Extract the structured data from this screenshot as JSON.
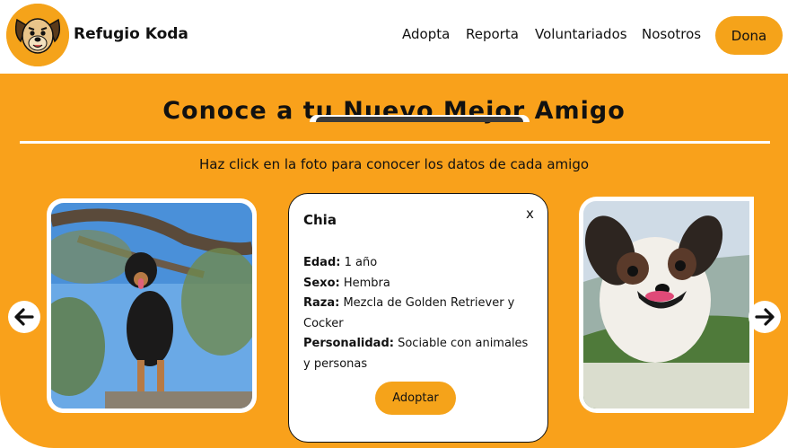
{
  "header": {
    "brand": "Refugio Koda",
    "nav": [
      "Adopta",
      "Reporta",
      "Voluntariados",
      "Nosotros"
    ],
    "donate_label": "Dona"
  },
  "hero": {
    "title": "Conoce a tu Nuevo Mejor Amigo",
    "subtitle": "Haz click en la foto para conocer los datos de cada amigo"
  },
  "modal": {
    "name": "Chia",
    "close": "x",
    "fields": [
      {
        "label": "Edad:",
        "value": "1 año"
      },
      {
        "label": "Sexo:",
        "value": "Hembra"
      },
      {
        "label": "Raza:",
        "value": "Mezcla de Golden Retriever y Cocker"
      },
      {
        "label": "Personalidad:",
        "value": "Sociable con animales y personas"
      }
    ],
    "adopt_label": "Adoptar"
  },
  "colors": {
    "accent": "#f9a11b",
    "button": "#f5a31a",
    "text": "#111111",
    "background": "#ffffff"
  },
  "icons": {
    "logo": "dog-face-icon",
    "prev": "arrow-left-icon",
    "next": "arrow-right-icon"
  }
}
